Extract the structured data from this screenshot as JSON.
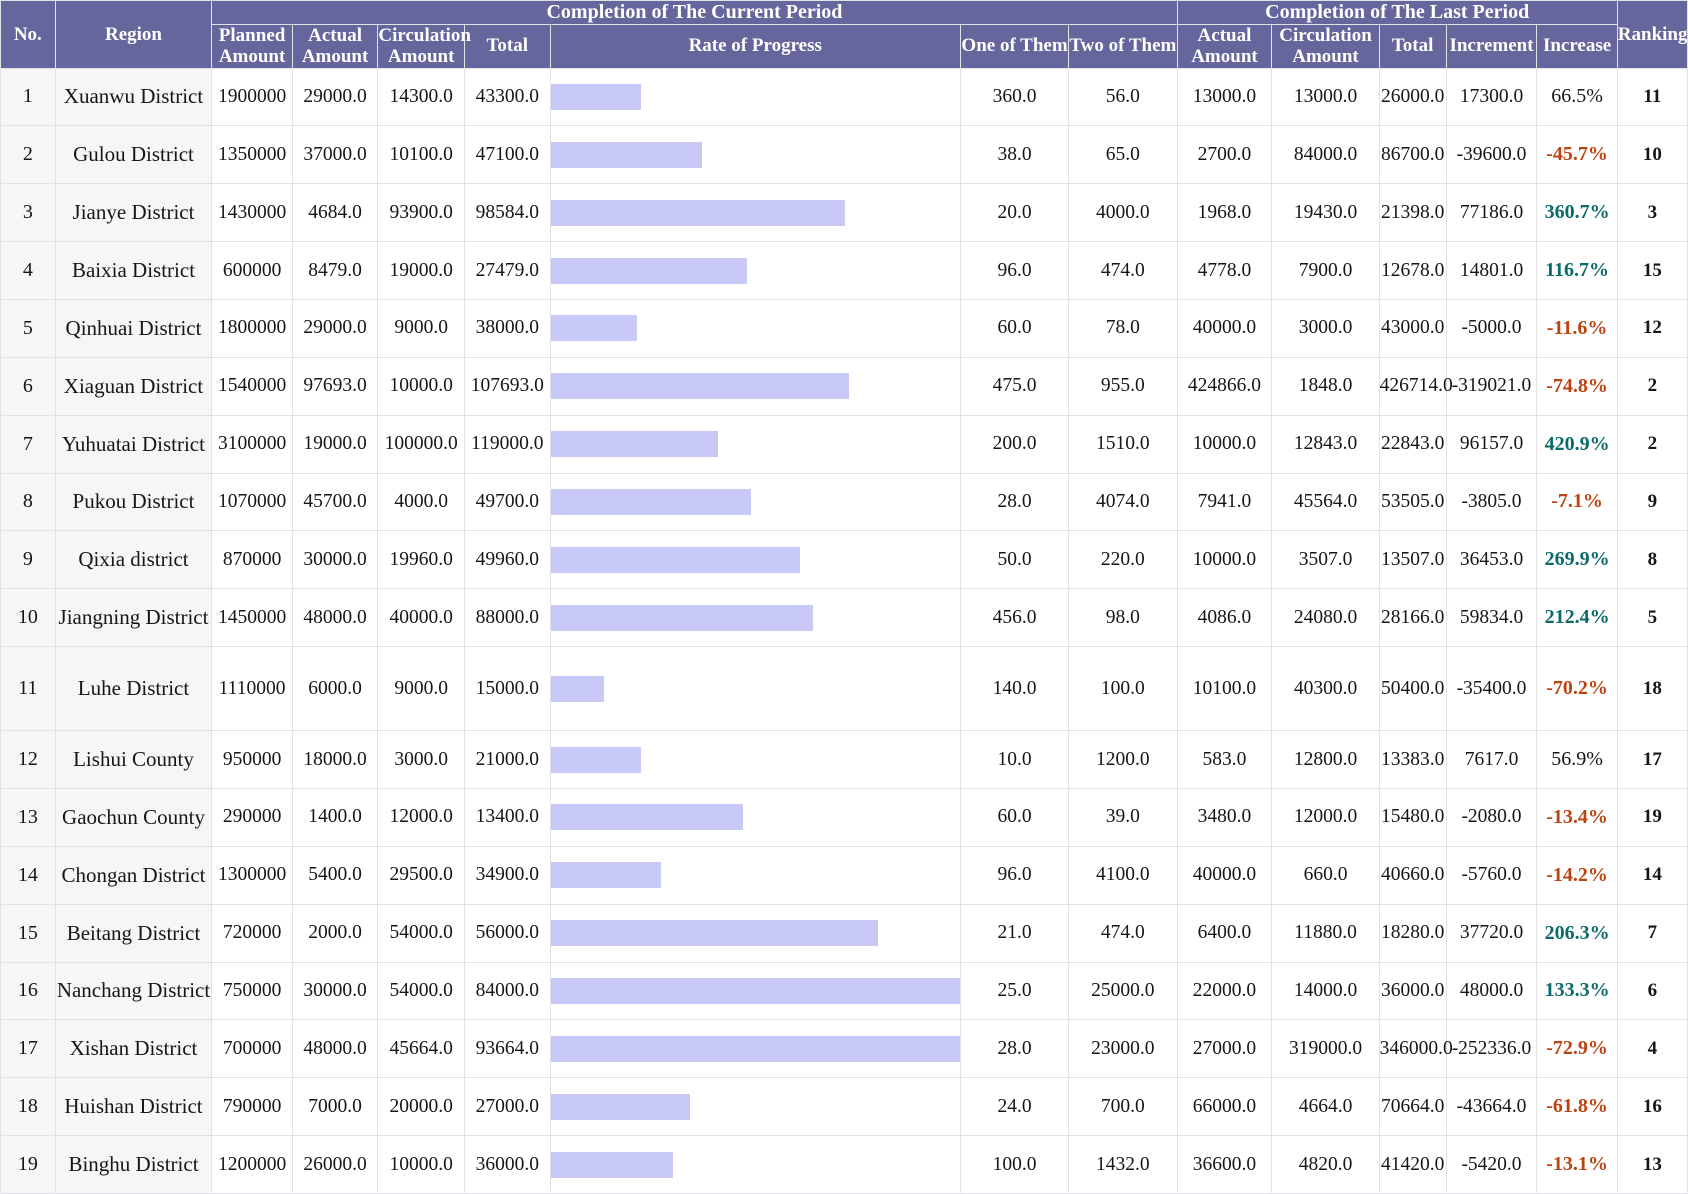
{
  "header": {
    "no": "No.",
    "region": "Region",
    "group_current": "Completion of The Current Period",
    "group_last": "Completion of The Last Period",
    "planned_amount": "Planned Amount",
    "actual_amount": "Actual Amount",
    "circulation_amount": "Circulation Amount",
    "total": "Total",
    "rate_of_progress": "Rate of Progress",
    "one_of_them": "One of Them",
    "two_of_them": "Two of Them",
    "last_actual_amount": "Actual Amount",
    "last_circulation_amount": "Circulation Amount",
    "last_total": "Total",
    "increment": "Increment",
    "increase": "Increase",
    "ranking": "Ranking"
  },
  "colors": {
    "header_bg": "#64669c",
    "header_text": "#ffffff",
    "bar_fill": "#c9c9f7",
    "increase_positive": "#0d6a6a",
    "increase_negative": "#bb4412",
    "row_label_bg": "#f6f6f7",
    "grid_line": "#e2e2e6"
  },
  "chart_data": {
    "type": "bar",
    "title": "Rate of Progress",
    "xlabel": "",
    "ylabel": "Region",
    "categories": [
      "Xuanwu District",
      "Gulou District",
      "Jianye District",
      "Baixia District",
      "Qinhuai District",
      "Xiaguan District",
      "Yuhuatai District",
      "Pukou District",
      "Qixia district",
      "Jiangning District",
      "Luhe District",
      "Lishui County",
      "Gaochun County",
      "Chongan District",
      "Beitang District",
      "Nanchang District",
      "Xishan District",
      "Huishan District",
      "Binghu District"
    ],
    "values": [
      22,
      37,
      72,
      48,
      21,
      73,
      41,
      49,
      61,
      64,
      13,
      22,
      47,
      27,
      80,
      100,
      100,
      34,
      30
    ],
    "value_unit": "percent of column width",
    "grid": false,
    "legend": "none"
  },
  "rows": [
    {
      "no": "1",
      "region": "Xuanwu District",
      "planned": "1900000",
      "actual": "29000.0",
      "circ": "14300.0",
      "total": "43300.0",
      "bar": 22,
      "one": "360.0",
      "two": "56.0",
      "lactual": "13000.0",
      "lcirc": "13000.0",
      "ltotal": "26000.0",
      "incr": "17300.0",
      "increase": "66.5%",
      "increase_dir": "flat",
      "rank": "11",
      "tall": false
    },
    {
      "no": "2",
      "region": "Gulou District",
      "planned": "1350000",
      "actual": "37000.0",
      "circ": "10100.0",
      "total": "47100.0",
      "bar": 37,
      "one": "38.0",
      "two": "65.0",
      "lactual": "2700.0",
      "lcirc": "84000.0",
      "ltotal": "86700.0",
      "incr": "-39600.0",
      "increase": "-45.7%",
      "increase_dir": "down",
      "rank": "10",
      "tall": false
    },
    {
      "no": "3",
      "region": "Jianye District",
      "planned": "1430000",
      "actual": "4684.0",
      "circ": "93900.0",
      "total": "98584.0",
      "bar": 72,
      "one": "20.0",
      "two": "4000.0",
      "lactual": "1968.0",
      "lcirc": "19430.0",
      "ltotal": "21398.0",
      "incr": "77186.0",
      "increase": "360.7%",
      "increase_dir": "up",
      "rank": "3",
      "tall": false
    },
    {
      "no": "4",
      "region": "Baixia District",
      "planned": "600000",
      "actual": "8479.0",
      "circ": "19000.0",
      "total": "27479.0",
      "bar": 48,
      "one": "96.0",
      "two": "474.0",
      "lactual": "4778.0",
      "lcirc": "7900.0",
      "ltotal": "12678.0",
      "incr": "14801.0",
      "increase": "116.7%",
      "increase_dir": "up",
      "rank": "15",
      "tall": false
    },
    {
      "no": "5",
      "region": "Qinhuai District",
      "planned": "1800000",
      "actual": "29000.0",
      "circ": "9000.0",
      "total": "38000.0",
      "bar": 21,
      "one": "60.0",
      "two": "78.0",
      "lactual": "40000.0",
      "lcirc": "3000.0",
      "ltotal": "43000.0",
      "incr": "-5000.0",
      "increase": "-11.6%",
      "increase_dir": "down",
      "rank": "12",
      "tall": false
    },
    {
      "no": "6",
      "region": "Xiaguan District",
      "planned": "1540000",
      "actual": "97693.0",
      "circ": "10000.0",
      "total": "107693.0",
      "bar": 73,
      "one": "475.0",
      "two": "955.0",
      "lactual": "424866.0",
      "lcirc": "1848.0",
      "ltotal": "426714.0",
      "incr": "-319021.0",
      "increase": "-74.8%",
      "increase_dir": "down",
      "rank": "2",
      "tall": false
    },
    {
      "no": "7",
      "region": "Yuhuatai District",
      "planned": "3100000",
      "actual": "19000.0",
      "circ": "100000.0",
      "total": "119000.0",
      "bar": 41,
      "one": "200.0",
      "two": "1510.0",
      "lactual": "10000.0",
      "lcirc": "12843.0",
      "ltotal": "22843.0",
      "incr": "96157.0",
      "increase": "420.9%",
      "increase_dir": "up",
      "rank": "2",
      "tall": false
    },
    {
      "no": "8",
      "region": "Pukou District",
      "planned": "1070000",
      "actual": "45700.0",
      "circ": "4000.0",
      "total": "49700.0",
      "bar": 49,
      "one": "28.0",
      "two": "4074.0",
      "lactual": "7941.0",
      "lcirc": "45564.0",
      "ltotal": "53505.0",
      "incr": "-3805.0",
      "increase": "-7.1%",
      "increase_dir": "down",
      "rank": "9",
      "tall": false
    },
    {
      "no": "9",
      "region": "Qixia district",
      "planned": "870000",
      "actual": "30000.0",
      "circ": "19960.0",
      "total": "49960.0",
      "bar": 61,
      "one": "50.0",
      "two": "220.0",
      "lactual": "10000.0",
      "lcirc": "3507.0",
      "ltotal": "13507.0",
      "incr": "36453.0",
      "increase": "269.9%",
      "increase_dir": "up",
      "rank": "8",
      "tall": false
    },
    {
      "no": "10",
      "region": "Jiangning District",
      "planned": "1450000",
      "actual": "48000.0",
      "circ": "40000.0",
      "total": "88000.0",
      "bar": 64,
      "one": "456.0",
      "two": "98.0",
      "lactual": "4086.0",
      "lcirc": "24080.0",
      "ltotal": "28166.0",
      "incr": "59834.0",
      "increase": "212.4%",
      "increase_dir": "up",
      "rank": "5",
      "tall": false
    },
    {
      "no": "11",
      "region": "Luhe District",
      "planned": "1110000",
      "actual": "6000.0",
      "circ": "9000.0",
      "total": "15000.0",
      "bar": 13,
      "one": "140.0",
      "two": "100.0",
      "lactual": "10100.0",
      "lcirc": "40300.0",
      "ltotal": "50400.0",
      "incr": "-35400.0",
      "increase": "-70.2%",
      "increase_dir": "down",
      "rank": "18",
      "tall": true
    },
    {
      "no": "12",
      "region": "Lishui County",
      "planned": "950000",
      "actual": "18000.0",
      "circ": "3000.0",
      "total": "21000.0",
      "bar": 22,
      "one": "10.0",
      "two": "1200.0",
      "lactual": "583.0",
      "lcirc": "12800.0",
      "ltotal": "13383.0",
      "incr": "7617.0",
      "increase": "56.9%",
      "increase_dir": "flat",
      "rank": "17",
      "tall": false
    },
    {
      "no": "13",
      "region": "Gaochun County",
      "planned": "290000",
      "actual": "1400.0",
      "circ": "12000.0",
      "total": "13400.0",
      "bar": 47,
      "one": "60.0",
      "two": "39.0",
      "lactual": "3480.0",
      "lcirc": "12000.0",
      "ltotal": "15480.0",
      "incr": "-2080.0",
      "increase": "-13.4%",
      "increase_dir": "down",
      "rank": "19",
      "tall": false
    },
    {
      "no": "14",
      "region": "Chongan District",
      "planned": "1300000",
      "actual": "5400.0",
      "circ": "29500.0",
      "total": "34900.0",
      "bar": 27,
      "one": "96.0",
      "two": "4100.0",
      "lactual": "40000.0",
      "lcirc": "660.0",
      "ltotal": "40660.0",
      "incr": "-5760.0",
      "increase": "-14.2%",
      "increase_dir": "down",
      "rank": "14",
      "tall": false
    },
    {
      "no": "15",
      "region": "Beitang District",
      "planned": "720000",
      "actual": "2000.0",
      "circ": "54000.0",
      "total": "56000.0",
      "bar": 80,
      "one": "21.0",
      "two": "474.0",
      "lactual": "6400.0",
      "lcirc": "11880.0",
      "ltotal": "18280.0",
      "incr": "37720.0",
      "increase": "206.3%",
      "increase_dir": "up",
      "rank": "7",
      "tall": false
    },
    {
      "no": "16",
      "region": "Nanchang District",
      "planned": "750000",
      "actual": "30000.0",
      "circ": "54000.0",
      "total": "84000.0",
      "bar": 100,
      "one": "25.0",
      "two": "25000.0",
      "lactual": "22000.0",
      "lcirc": "14000.0",
      "ltotal": "36000.0",
      "incr": "48000.0",
      "increase": "133.3%",
      "increase_dir": "up",
      "rank": "6",
      "tall": false
    },
    {
      "no": "17",
      "region": "Xishan District",
      "planned": "700000",
      "actual": "48000.0",
      "circ": "45664.0",
      "total": "93664.0",
      "bar": 100,
      "one": "28.0",
      "two": "23000.0",
      "lactual": "27000.0",
      "lcirc": "319000.0",
      "ltotal": "346000.0",
      "incr": "-252336.0",
      "increase": "-72.9%",
      "increase_dir": "down",
      "rank": "4",
      "tall": false
    },
    {
      "no": "18",
      "region": "Huishan District",
      "planned": "790000",
      "actual": "7000.0",
      "circ": "20000.0",
      "total": "27000.0",
      "bar": 34,
      "one": "24.0",
      "two": "700.0",
      "lactual": "66000.0",
      "lcirc": "4664.0",
      "ltotal": "70664.0",
      "incr": "-43664.0",
      "increase": "-61.8%",
      "increase_dir": "down",
      "rank": "16",
      "tall": false
    },
    {
      "no": "19",
      "region": "Binghu District",
      "planned": "1200000",
      "actual": "26000.0",
      "circ": "10000.0",
      "total": "36000.0",
      "bar": 30,
      "one": "100.0",
      "two": "1432.0",
      "lactual": "36600.0",
      "lcirc": "4820.0",
      "ltotal": "41420.0",
      "incr": "-5420.0",
      "increase": "-13.1%",
      "increase_dir": "down",
      "rank": "13",
      "tall": false
    }
  ]
}
